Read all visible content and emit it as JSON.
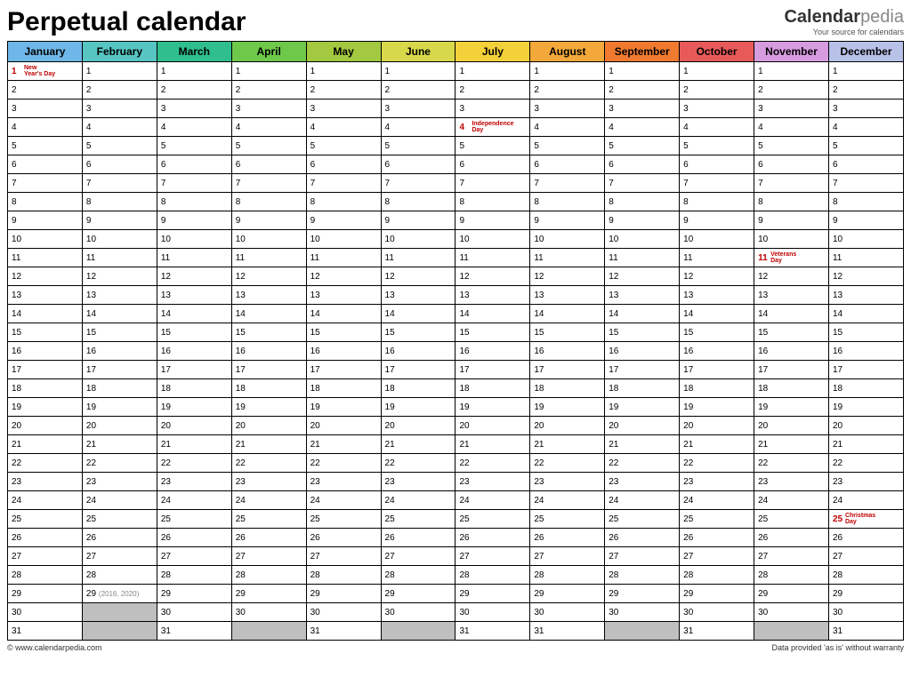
{
  "title": "Perpetual calendar",
  "brand": {
    "name1": "Calendar",
    "name2": "pedia",
    "tagline": "Your source for calendars"
  },
  "footer": {
    "left": "© www.calendarpedia.com",
    "right": "Data provided 'as is' without warranty"
  },
  "months": [
    {
      "name": "January",
      "bg": "#6fb7e8",
      "days": 31
    },
    {
      "name": "February",
      "bg": "#57c6c3",
      "days": 29
    },
    {
      "name": "March",
      "bg": "#2fbf8f",
      "days": 31
    },
    {
      "name": "April",
      "bg": "#6ec94a",
      "days": 30
    },
    {
      "name": "May",
      "bg": "#a2c940",
      "days": 31
    },
    {
      "name": "June",
      "bg": "#d8d94a",
      "days": 30
    },
    {
      "name": "July",
      "bg": "#f4d13a",
      "days": 31
    },
    {
      "name": "August",
      "bg": "#f3a93a",
      "days": 31
    },
    {
      "name": "September",
      "bg": "#ef7a30",
      "days": 30
    },
    {
      "name": "October",
      "bg": "#e85a5a",
      "days": 31
    },
    {
      "name": "November",
      "bg": "#d79be0",
      "days": 30
    },
    {
      "name": "December",
      "bg": "#b8c1e8",
      "days": 31
    }
  ],
  "max_rows": 31,
  "holidays": {
    "0-1": "New Year's Day",
    "6-4": "Independence Day",
    "10-11": "Veterans Day",
    "11-25": "Christmas Day"
  },
  "leap_note": {
    "month": 1,
    "day": 29,
    "text": "(2016, 2020)"
  }
}
